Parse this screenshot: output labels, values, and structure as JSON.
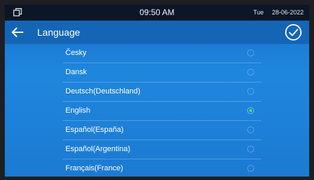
{
  "status": {
    "time": "09:50 AM",
    "day": "Tue",
    "date": "28-06-2022"
  },
  "header": {
    "title": "Language",
    "back_icon": "arrow-left-icon",
    "confirm_icon": "check-circle-icon"
  },
  "languages": [
    {
      "label": "Česky",
      "selected": false
    },
    {
      "label": "Dansk",
      "selected": false
    },
    {
      "label": "Deutsch(Deutschland)",
      "selected": false
    },
    {
      "label": "English",
      "selected": true
    },
    {
      "label": "Español(España)",
      "selected": false
    },
    {
      "label": "Español(Argentina)",
      "selected": false
    },
    {
      "label": "Français(France)",
      "selected": false
    }
  ],
  "colors": {
    "statusbar": "#0b1626",
    "titlebar": "#1565b7",
    "background": "#1f86de",
    "selected_dot": "#58e06a"
  }
}
